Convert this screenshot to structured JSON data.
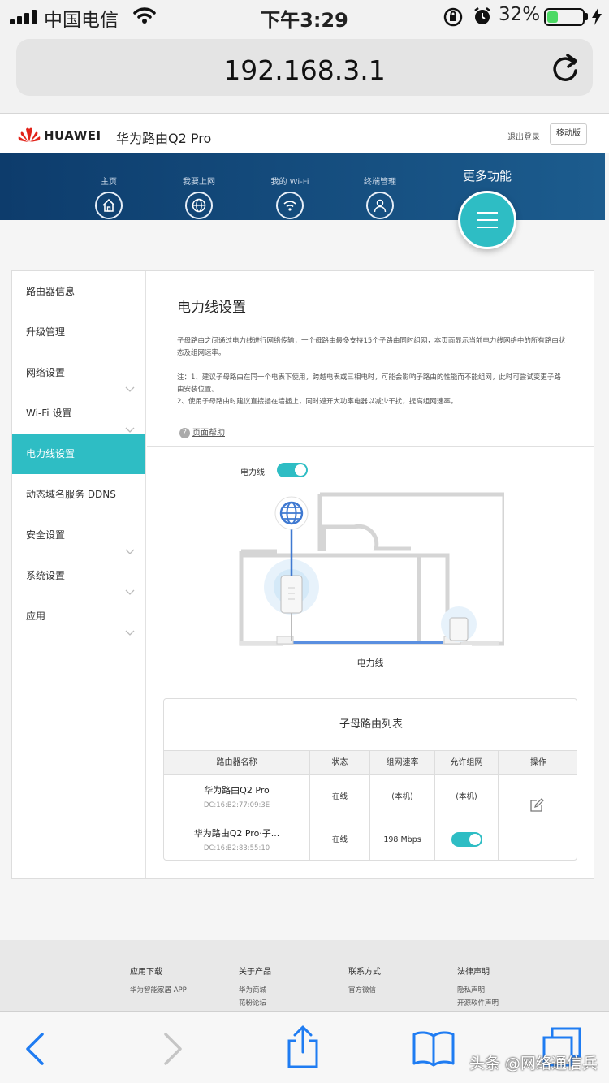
{
  "status_bar": {
    "carrier": "中国电信",
    "time": "下午3:29",
    "battery_percent": "32%",
    "battery_level": 0.32,
    "colors": {
      "battery": "#4cd964"
    }
  },
  "address_bar": {
    "url": "192.168.3.1"
  },
  "site_header": {
    "brand": "HUAWEI",
    "product": "华为路由Q2 Pro",
    "logout": "退出登录",
    "mobile_version": "移动版"
  },
  "top_nav": {
    "items": [
      {
        "label": "主页",
        "icon": "home-icon"
      },
      {
        "label": "我要上网",
        "icon": "globe-icon"
      },
      {
        "label": "我的 Wi-Fi",
        "icon": "wifi-icon"
      },
      {
        "label": "终端管理",
        "icon": "user-icon"
      }
    ],
    "more": "更多功能",
    "colors": {
      "accent": "#2ebdc4",
      "band": "#0d3c6c"
    }
  },
  "sidebar": {
    "items": [
      {
        "label": "路由器信息",
        "expandable": false,
        "active": false
      },
      {
        "label": "升级管理",
        "expandable": false,
        "active": false
      },
      {
        "label": "网络设置",
        "expandable": true,
        "active": false
      },
      {
        "label": "Wi-Fi 设置",
        "expandable": true,
        "active": false
      },
      {
        "label": "电力线设置",
        "expandable": false,
        "active": true
      },
      {
        "label": "动态域名服务 DDNS",
        "expandable": false,
        "active": false
      },
      {
        "label": "安全设置",
        "expandable": true,
        "active": false
      },
      {
        "label": "系统设置",
        "expandable": true,
        "active": false
      },
      {
        "label": "应用",
        "expandable": true,
        "active": false
      }
    ]
  },
  "main": {
    "title": "电力线设置",
    "description": "子母路由之间通过电力线进行网络传输，一个母路由最多支持15个子路由同时组网，本页面显示当前电力线网络中的所有路由状态及组网速率。",
    "note1": "注：1、建议子母路由在同一个电表下使用，跨越电表或三相电时，可能会影响子路由的性能而不能组网，此时可尝试变更子路由安装位置。",
    "note2": "2、使用子母路由时建议直接插在墙插上，同时避开大功率电器以减少干扰，提高组网速率。",
    "help": "页面帮助",
    "plc_toggle_label": "电力线",
    "plc_enabled": true,
    "diagram_caption": "电力线",
    "list": {
      "title": "子母路由列表",
      "headers": [
        "路由器名称",
        "状态",
        "组网速率",
        "允许组网",
        "操作"
      ],
      "rows": [
        {
          "name": "华为路由Q2 Pro",
          "mac": "DC:16:B2:77:09:3E",
          "status": "在线",
          "rate": "(本机)",
          "allow": "(本机)",
          "action": "edit-icon"
        },
        {
          "name": "华为路由Q2 Pro·子...",
          "mac": "DC:16:B2:83:55:10",
          "status": "在线",
          "rate": "198 Mbps",
          "allow_enabled": true,
          "action": ""
        }
      ]
    }
  },
  "footer": {
    "columns": [
      {
        "heading": "应用下载",
        "links": [
          "华为智能家居 APP"
        ]
      },
      {
        "heading": "关于产品",
        "links": [
          "华为商城",
          "花粉论坛"
        ]
      },
      {
        "heading": "联系方式",
        "links": [
          "官方微信"
        ]
      },
      {
        "heading": "法律声明",
        "links": [
          "隐私声明",
          "开源软件声明"
        ]
      }
    ]
  },
  "toolbar": {
    "buttons": [
      "back-icon",
      "forward-icon",
      "share-icon",
      "bookmarks-icon",
      "tabs-icon"
    ]
  },
  "watermark": "头条 @网络通信兵"
}
